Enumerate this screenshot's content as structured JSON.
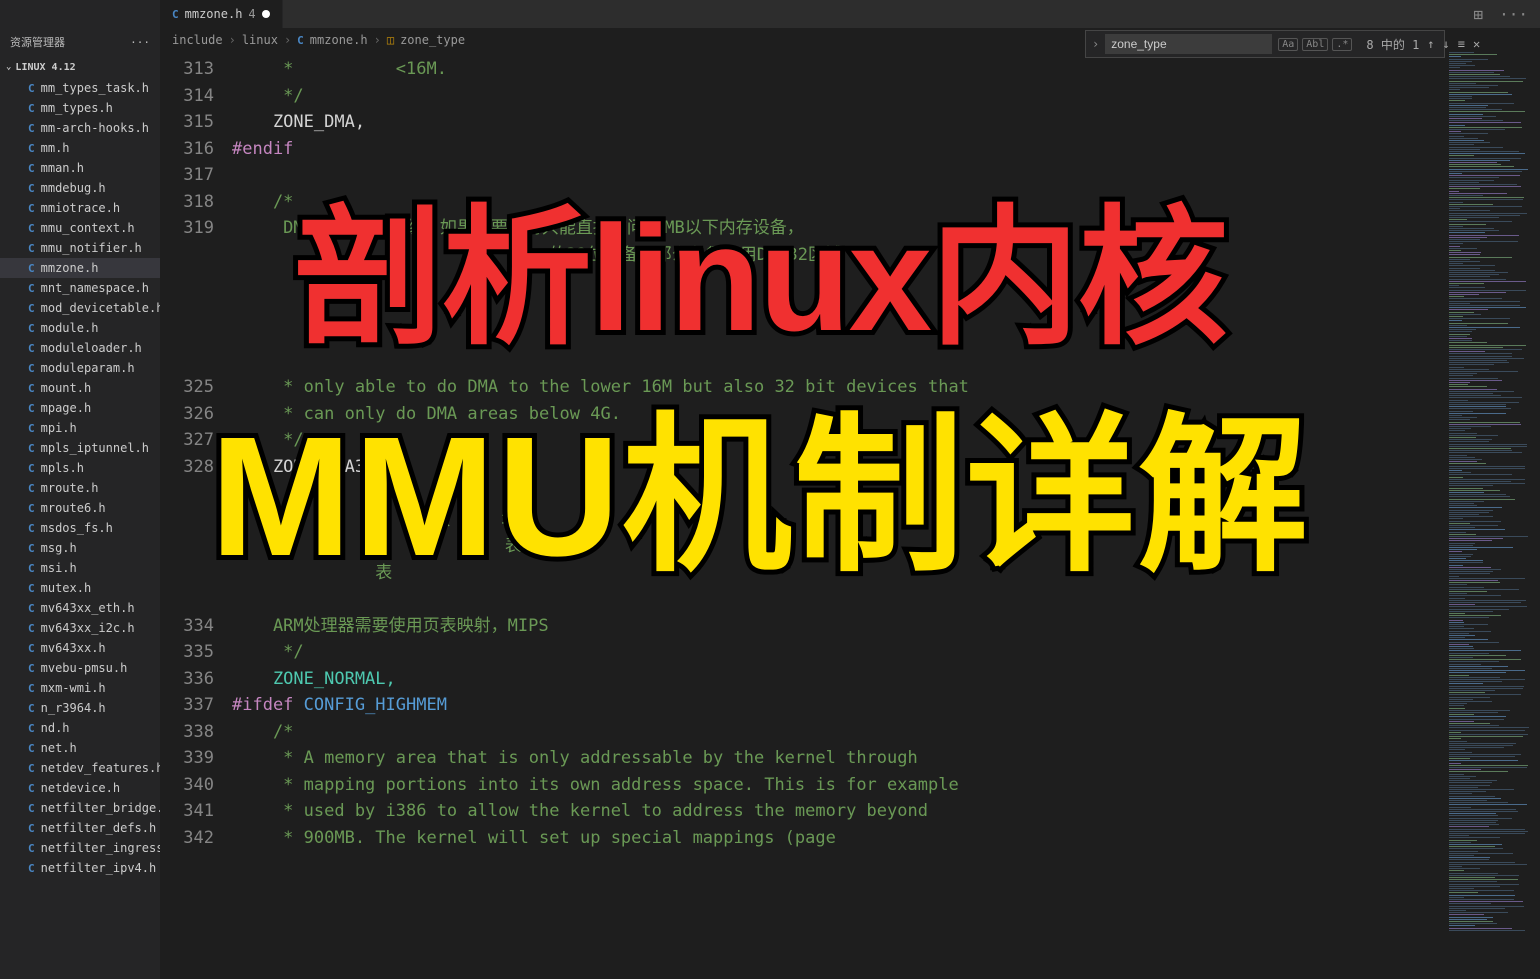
{
  "titlebar": {
    "explorer_label": "资源管理器",
    "layout_icon": "⊞",
    "more_icon": "···"
  },
  "tab": {
    "icon": "C",
    "name": "mmzone.h",
    "modified_count": "4"
  },
  "folder": {
    "name": "LINUX 4.12"
  },
  "files": [
    "mm_types_task.h",
    "mm_types.h",
    "mm-arch-hooks.h",
    "mm.h",
    "mman.h",
    "mmdebug.h",
    "mmiotrace.h",
    "mmu_context.h",
    "mmu_notifier.h",
    "mmzone.h",
    "mnt_namespace.h",
    "mod_devicetable.h",
    "module.h",
    "moduleloader.h",
    "moduleparam.h",
    "mount.h",
    "mpage.h",
    "mpi.h",
    "mpls_iptunnel.h",
    "mpls.h",
    "mroute.h",
    "mroute6.h",
    "msdos_fs.h",
    "msg.h",
    "msi.h",
    "mutex.h",
    "mv643xx_eth.h",
    "mv643xx_i2c.h",
    "mv643xx.h",
    "mvebu-pmsu.h",
    "mxm-wmi.h",
    "n_r3964.h",
    "nd.h",
    "net.h",
    "netdev_features.h",
    "netdevice.h",
    "netfilter_bridge.h",
    "netfilter_defs.h",
    "netfilter_ingress.h",
    "netfilter_ipv4.h"
  ],
  "active_file_index": 9,
  "breadcrumbs": {
    "p1": "include",
    "p2": "linux",
    "p3_icon": "C",
    "p3": "mmzone.h",
    "p4_icon": "◫",
    "p4": "zone_type"
  },
  "find": {
    "value": "zone_type",
    "opt_case": "Aa",
    "opt_word": "Abl",
    "opt_regex": ".*",
    "count": "8 中的 1",
    "up": "↑",
    "down": "↓",
    "sel": "≡",
    "close": "✕"
  },
  "line_numbers": [
    "313",
    "314",
    "315",
    "316",
    "317",
    "318",
    "319",
    "",
    "",
    "",
    "",
    "",
    "325",
    "326",
    "327",
    "328",
    "",
    "",
    "",
    "",
    "",
    "334",
    "335",
    "336",
    "337",
    "338",
    "339",
    "340",
    "341",
    "342"
  ],
  "code_lines": [
    {
      "cls": "tok-comment",
      "text": "     *          <16M."
    },
    {
      "cls": "tok-comment",
      "text": "     */"
    },
    {
      "cls": "tok-identifier",
      "text": "    ZONE_DMA,"
    },
    {
      "cls": "tok-pp",
      "text": "#endif"
    },
    {
      "cls": "",
      "text": ""
    },
    {
      "cls": "tok-comment",
      "text": "    /*"
    },
    {
      "cls": "tok-comment",
      "text": "     DMA32：64位系统，如果既要支持只能直接访问16MB以下内存设备，"
    },
    {
      "cls": "tok-comment",
      "text": "                               的32位设备，那么必须使用DMA32区域"
    },
    {
      "cls": "",
      "text": ""
    },
    {
      "cls": "",
      "text": ""
    },
    {
      "cls": "",
      "text": ""
    },
    {
      "cls": "",
      "text": ""
    },
    {
      "cls": "tok-comment",
      "text": "     * only able to do DMA to the lower 16M but also 32 bit devices that"
    },
    {
      "cls": "tok-comment",
      "text": "     * can only do DMA areas below 4G."
    },
    {
      "cls": "tok-comment",
      "text": "     */"
    },
    {
      "cls": "tok-identifier",
      "text": "    ZONE_DMA32,"
    },
    {
      "cls": "",
      "text": ""
    },
    {
      "cls": "tok-comment",
      "text": "                  内核     地"
    },
    {
      "cls": "tok-comment",
      "text": "              核           表"
    },
    {
      "cls": "tok-comment",
      "text": "              表"
    },
    {
      "cls": "",
      "text": ""
    },
    {
      "cls": "tok-comment",
      "text": "    ARM处理器需要使用页表映射，MIPS"
    },
    {
      "cls": "tok-comment",
      "text": "     */"
    },
    {
      "cls": "tok-enum",
      "text": "    ZONE_NORMAL,"
    },
    {
      "cls": "tok-pp",
      "text": "#ifdef ",
      "text2": "CONFIG_HIGHMEM",
      "cls2": "tok-define"
    },
    {
      "cls": "tok-comment",
      "text": "    /*"
    },
    {
      "cls": "tok-comment",
      "text": "     * A memory area that is only addressable by the kernel through"
    },
    {
      "cls": "tok-comment",
      "text": "     * mapping portions into its own address space. This is for example"
    },
    {
      "cls": "tok-comment",
      "text": "     * used by i386 to allow the kernel to address the memory beyond"
    },
    {
      "cls": "tok-comment",
      "text": "     * 900MB. The kernel will set up special mappings (page"
    }
  ],
  "overlay": {
    "line1": "剖析linux内核",
    "line2": "MMU机制详解"
  }
}
